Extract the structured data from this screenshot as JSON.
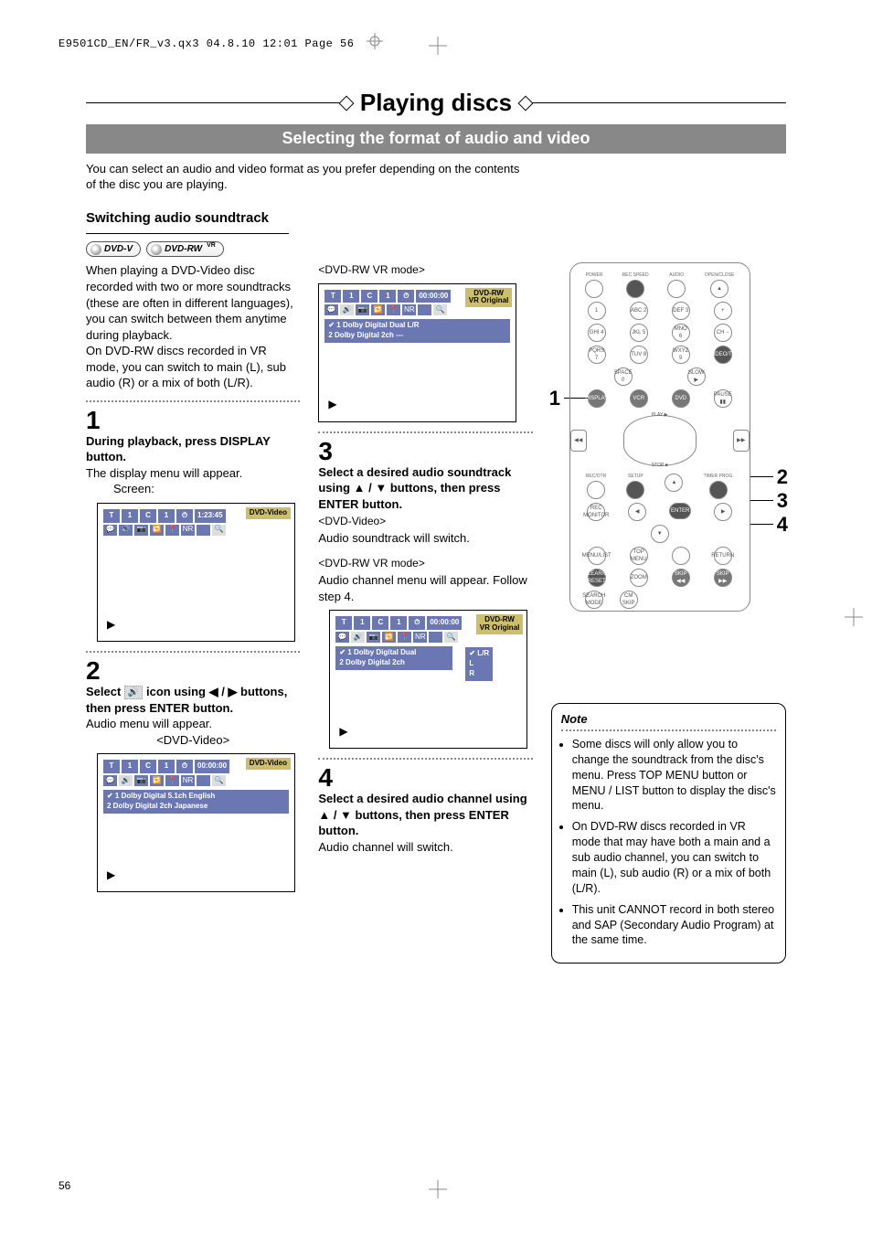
{
  "printer_header": "E9501CD_EN/FR_v3.qx3  04.8.10  12:01  Page 56",
  "section_title": "Playing discs",
  "sub_banner": "Selecting the format of audio and video",
  "intro_text": "You can select an audio and video format as you prefer depending on the contents of the disc you are playing.",
  "sub_heading": "Switching audio soundtrack",
  "badges": {
    "dvd_v": "DVD-V",
    "dvd_rw": "DVD-RW",
    "vr_tag": "VR"
  },
  "left_para": "When playing a DVD-Video disc recorded with two or more soundtracks (these are often in different languages), you can switch between them anytime during playback.\nOn DVD-RW discs recorded in VR mode, you can switch to main (L), sub audio (R) or a mix of both (L/R).",
  "step1": {
    "num": "1",
    "bold": "During playback, press DISPLAY button.",
    "text": "The display menu will appear.",
    "screen_label": "Screen:",
    "osd": {
      "top": [
        "T",
        "1",
        "C",
        "1",
        "⏱",
        "1:23:45"
      ],
      "side_tag": "DVD-Video"
    }
  },
  "step2": {
    "num": "2",
    "bold_pre": "Select ",
    "bold_mid_icon": "🔊",
    "bold_post": " icon using ◀ / ▶ buttons, then press ENTER button.",
    "text": "Audio menu will appear.",
    "mode_label": "<DVD-Video>",
    "osd": {
      "top": [
        "T",
        "1",
        "C",
        "1",
        "⏱",
        "00:00:00"
      ],
      "side_tag": "DVD-Video",
      "list": [
        "✔ 1 Dolby Digital  5.1ch  English",
        "   2 Dolby Digital  2ch  Japanese"
      ]
    }
  },
  "step3_header_mode": "<DVD-RW VR mode>",
  "osd_vr1": {
    "top": [
      "T",
      "1",
      "C",
      "1",
      "⏱",
      "00:00:00"
    ],
    "side_tag": "DVD-RW\nVR Original",
    "list": [
      "✔ 1 Dolby Digital   Dual   L/R",
      "   2 Dolby Digital   2ch   ---"
    ]
  },
  "step3": {
    "num": "3",
    "bold": "Select a desired audio soundtrack using ▲ / ▼ buttons, then press ENTER button.",
    "mode_label_1": "<DVD-Video>",
    "text_1": "Audio soundtrack will switch.",
    "mode_label_2": "<DVD-RW VR mode>",
    "text_2": "Audio channel menu will appear. Follow step 4.",
    "osd": {
      "top": [
        "T",
        "1",
        "C",
        "1",
        "⏱",
        "00:00:00"
      ],
      "side_tag": "DVD-RW\nVR Original",
      "list": [
        "✔ 1 Dolby Digital   Dual",
        "   2 Dolby Digital   2ch"
      ],
      "sublist": [
        "✔ L/R",
        "   L",
        "   R"
      ]
    }
  },
  "step4": {
    "num": "4",
    "bold": "Select a desired audio channel using ▲ / ▼ buttons, then press ENTER button.",
    "text": "Audio channel will switch."
  },
  "remote_callouts": {
    "c1": "1",
    "c2": "2",
    "c3": "3",
    "c4": "4"
  },
  "remote_labels": {
    "row1": [
      "POWER",
      "REC SPEED",
      "AUDIO",
      "OPEN/CLOSE"
    ],
    "row2": [
      "1",
      "ABC 2",
      "DEF 3",
      "+"
    ],
    "row3": [
      "GHI 4",
      "JKL 5",
      "MNO 6",
      "CH −"
    ],
    "row4": [
      "PQRS 7",
      "TUV 8",
      "WXYZ 9",
      "VIDEO/TV"
    ],
    "row5": [
      "SPACE 0",
      "SLOW ▶"
    ],
    "row6": [
      "DISPLAY",
      "VCR",
      "DVD",
      "PAUSE ▮▮"
    ],
    "nav": {
      "top": "PLAY ▶",
      "bottom": "STOP ■",
      "left": "◀◀",
      "right": "▶▶"
    },
    "row7": [
      "REC/OTR",
      "SETUP",
      "▲",
      "TIMER PROG."
    ],
    "row7b": [
      "",
      "◀",
      "ENTER",
      "▶",
      ""
    ],
    "row8": [
      "REC MONITOR",
      "",
      "▼",
      ""
    ],
    "row9": [
      "MENU/LIST",
      "TOP MENU",
      "",
      "RETURN"
    ],
    "row10": [
      "CLEAR/C-RESET",
      "ZOOM",
      "SKIP ◀◀",
      "SKIP ▶▶"
    ],
    "row11": [
      "SEARCH MODE",
      "CM SKIP",
      "",
      ""
    ]
  },
  "note": {
    "title": "Note",
    "items": [
      "Some discs will only allow you to change the soundtrack from the disc's menu. Press TOP MENU button or MENU / LIST button to display the disc's menu.",
      "On DVD-RW discs recorded in VR mode that may have both a main and a sub audio channel, you can switch to main (L), sub audio (R) or a mix of both (L/R).",
      "This unit CANNOT record in both stereo and SAP (Secondary Audio Program) at the same time."
    ]
  },
  "page_number": "56"
}
